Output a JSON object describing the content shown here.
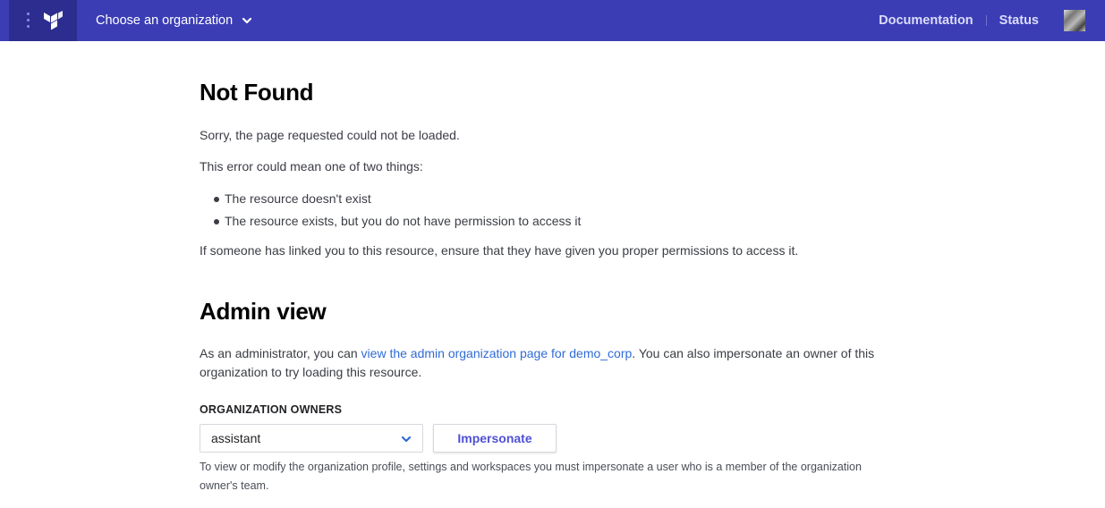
{
  "header": {
    "org_chooser_label": "Choose an organization",
    "links": [
      {
        "label": "Documentation"
      },
      {
        "label": "Status"
      }
    ],
    "colors": {
      "bar": "#3b3db5",
      "brand_block": "#2c2d8f"
    }
  },
  "icons": {
    "menu": "vertical-dots-icon",
    "logo": "terraform-logo-icon",
    "org_chevron": "chevron-down-icon",
    "avatar": "user-avatar",
    "select_chevron": "chevron-down-icon"
  },
  "not_found": {
    "title": "Not Found",
    "sorry_text": "Sorry, the page requested could not be loaded.",
    "intro_text": "This error could mean one of two things:",
    "reasons": [
      "The resource doesn't exist",
      "The resource exists, but you do not have permission to access it"
    ],
    "linked_text": "If someone has linked you to this resource, ensure that they have given you proper permissions to access it."
  },
  "admin": {
    "title": "Admin view",
    "text_before_link": "As an administrator, you can ",
    "link_text": "view the admin organization page for demo_corp",
    "text_after_link": ". You can also impersonate an owner of this organization to try loading this resource.",
    "owners_label": "ORGANIZATION OWNERS",
    "owners_selected": "assistant",
    "impersonate_label": "Impersonate",
    "help_text": "To view or modify the organization profile, settings and workspaces you must impersonate a user who is a member of the organization owner's team.",
    "link_color": "#2f6bd6",
    "button_text_color": "#4f50d4"
  }
}
